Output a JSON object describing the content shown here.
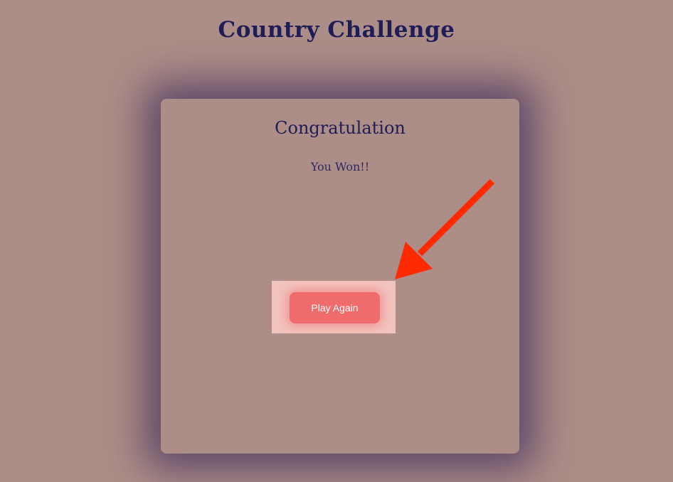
{
  "header": {
    "title": "Country Challenge"
  },
  "result_card": {
    "title": "Congratulation",
    "message": "You Won!!",
    "play_again_label": "Play Again"
  },
  "colors": {
    "background": "#ad8d87",
    "title_text": "#1f1d55",
    "button": "#f06c6c",
    "highlight": "#f2c4be",
    "annotation_arrow": "#ff2a00"
  }
}
